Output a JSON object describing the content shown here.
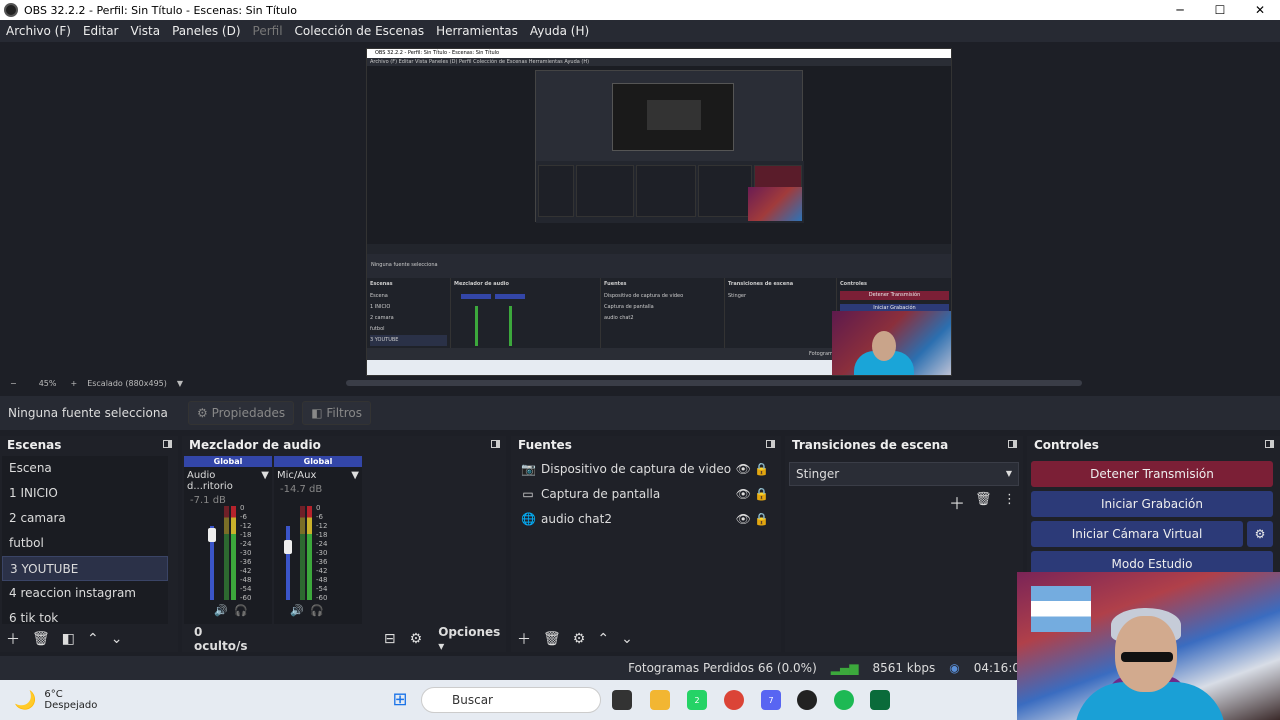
{
  "window": {
    "title": "OBS 32.2.2 - Perfil: Sin Título - Escenas: Sin Título",
    "minimize": "─",
    "maximize": "☐",
    "close": "✕"
  },
  "menu": {
    "items": [
      "Archivo (F)",
      "Editar",
      "Vista",
      "Paneles (D)",
      "Perfil",
      "Colección de Escenas",
      "Herramientas",
      "Ayuda (H)"
    ]
  },
  "preview_nested": {
    "title": "OBS 32.2.2 - Perfil: Sin Título - Escenas: Sin Título",
    "menu": "Archivo (F)   Editar   Vista   Paneles (D)   Perfil   Colección de Escenas   Herramientas   Ayuda (H)",
    "source_label": "Ninguna fuente selecciona",
    "scenes_header": "Escenas",
    "mixer_header": "Mezclador de audio",
    "sources_header": "Fuentes",
    "transitions_header": "Transiciones de escena",
    "controls_header": "Controles",
    "status": "Fotogramas Perdidos 66 (0.0%)   8561 kbps   04:16:"
  },
  "zoom": {
    "minus": "−",
    "level": "45%",
    "plus": "+",
    "scale_label": "Escalado (880x495)"
  },
  "source_bar": {
    "label": "Ninguna fuente selecciona",
    "properties": "Propiedades",
    "filters": "Filtros"
  },
  "scenes": {
    "header": "Escenas",
    "items": [
      "Escena",
      "1 INICIO",
      "2 camara",
      "futbol",
      "3 YOUTUBE",
      "4 reaccion instagram",
      "6 tik tok"
    ],
    "selected_index": 4
  },
  "mixer": {
    "header": "Mezclador de audio",
    "channels": [
      {
        "global": "Global",
        "name": "Audio d...ritorio",
        "db": "-7.1 dB",
        "level": 0.64
      },
      {
        "global": "Global",
        "name": "Mic/Aux",
        "db": "-14.7 dB",
        "level": 0.45
      }
    ],
    "scale": [
      "0",
      "-6",
      "-12",
      "-18",
      "-24",
      "-30",
      "-36",
      "-42",
      "-48",
      "-54",
      "-60"
    ],
    "hidden_label": "0 oculto/s",
    "options_label": "Opciones"
  },
  "sources": {
    "header": "Fuentes",
    "items": [
      {
        "name": "Dispositivo de captura de video",
        "icon": "camera-icon"
      },
      {
        "name": "Captura de pantalla",
        "icon": "monitor-icon"
      },
      {
        "name": "audio chat2",
        "icon": "globe-icon"
      }
    ]
  },
  "transitions": {
    "header": "Transiciones de escena",
    "selected": "Stinger"
  },
  "controls": {
    "header": "Controles",
    "stop_stream": "Detener Transmisión",
    "start_record": "Iniciar Grabación",
    "start_vcam": "Iniciar Cámara Virtual",
    "studio_mode": "Modo Estudio",
    "colors": {
      "stop": "#7b1f36",
      "normal": "#2c3a78"
    }
  },
  "status": {
    "dropped": "Fotogramas Perdidos 66 (0.0%)",
    "bitrate": "8561 kbps",
    "time": "04:16:0"
  },
  "taskbar": {
    "temp": "6°C",
    "weather": "Despejado",
    "search_placeholder": "Buscar",
    "whatsapp_badge": "2",
    "discord_badge": "7"
  }
}
